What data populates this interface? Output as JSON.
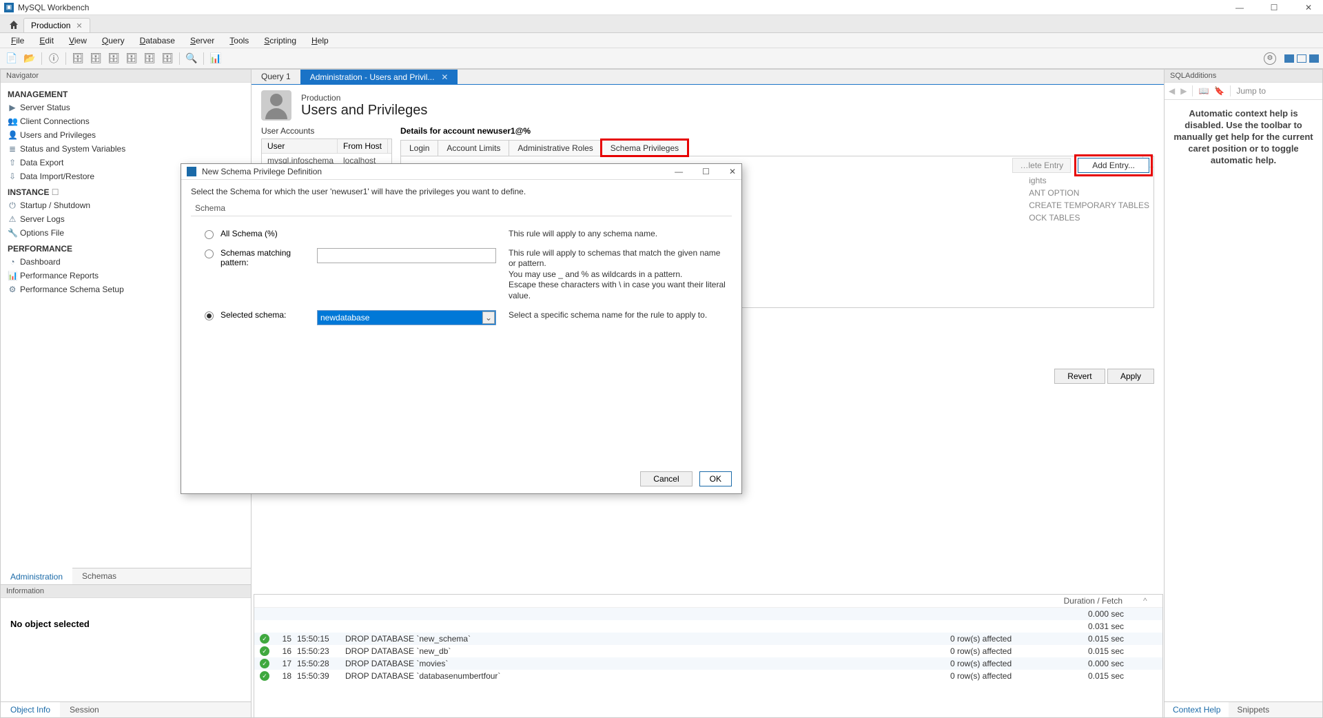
{
  "app": {
    "title": "MySQL Workbench"
  },
  "connection_tab": {
    "name": "Production"
  },
  "menu": [
    "File",
    "Edit",
    "View",
    "Query",
    "Database",
    "Server",
    "Tools",
    "Scripting",
    "Help"
  ],
  "navigator": {
    "title": "Navigator",
    "sections": {
      "management": {
        "label": "MANAGEMENT",
        "items": [
          "Server Status",
          "Client Connections",
          "Users and Privileges",
          "Status and System Variables",
          "Data Export",
          "Data Import/Restore"
        ]
      },
      "instance": {
        "label": "INSTANCE",
        "items": [
          "Startup / Shutdown",
          "Server Logs",
          "Options File"
        ]
      },
      "performance": {
        "label": "PERFORMANCE",
        "items": [
          "Dashboard",
          "Performance Reports",
          "Performance Schema Setup"
        ]
      }
    },
    "bottom_tabs": [
      "Administration",
      "Schemas"
    ],
    "info_header": "Information",
    "info_text": "No object selected",
    "obj_tabs": [
      "Object Info",
      "Session"
    ]
  },
  "center": {
    "tabs": [
      {
        "label": "Query 1",
        "active": false
      },
      {
        "label": "Administration - Users and Privil...",
        "active": true
      }
    ],
    "header": {
      "subtitle": "Production",
      "title": "Users and Privileges"
    },
    "user_accounts": {
      "label": "User Accounts",
      "columns": [
        "User",
        "From Host"
      ],
      "rows": [
        [
          "mysql.infoschema",
          "localhost"
        ]
      ]
    },
    "details": {
      "title": "Details for account newuser1@%",
      "tabs": [
        "Login",
        "Account Limits",
        "Administrative Roles",
        "Schema Privileges"
      ],
      "rights_hint_title": "ights",
      "rights": [
        "ANT OPTION",
        "CREATE TEMPORARY TABLES",
        "OCK TABLES"
      ],
      "delete_entry": "…lete Entry",
      "add_entry": "Add Entry...",
      "revert": "Revert",
      "apply": "Apply"
    }
  },
  "sqladd": {
    "title": "SQLAdditions",
    "jump": "Jump to",
    "help_text": "Automatic context help is disabled. Use the toolbar to manually get help for the current caret position or to toggle automatic help.",
    "tabs": [
      "Context Help",
      "Snippets"
    ]
  },
  "modal": {
    "title": "New Schema Privilege Definition",
    "instruction": "Select the Schema for which the user 'newuser1' will have the privileges you want to define.",
    "group": "Schema",
    "opt1_label": "All Schema (%)",
    "opt1_desc": "This rule will apply to any schema name.",
    "opt2_label": "Schemas matching pattern:",
    "opt2_desc": "This rule will apply to schemas that match the given name or pattern.\nYou may use _ and % as wildcards in a pattern.\nEscape these characters with \\ in case you want their literal value.",
    "opt3_label": "Selected schema:",
    "opt3_value": "newdatabase",
    "opt3_desc": "Select a specific schema name for the rule to apply to.",
    "cancel": "Cancel",
    "ok": "OK"
  },
  "output": {
    "header_duration": "Duration / Fetch",
    "rows": [
      {
        "idx": "",
        "time": "",
        "sql": "",
        "affected": "",
        "duration": "0.000 sec"
      },
      {
        "idx": "",
        "time": "",
        "sql": "",
        "affected": "",
        "duration": "0.031 sec"
      },
      {
        "idx": "15",
        "time": "15:50:15",
        "sql": "DROP DATABASE `new_schema`",
        "affected": "0 row(s) affected",
        "duration": "0.015 sec"
      },
      {
        "idx": "16",
        "time": "15:50:23",
        "sql": "DROP DATABASE `new_db`",
        "affected": "0 row(s) affected",
        "duration": "0.015 sec"
      },
      {
        "idx": "17",
        "time": "15:50:28",
        "sql": "DROP DATABASE `movies`",
        "affected": "0 row(s) affected",
        "duration": "0.000 sec"
      },
      {
        "idx": "18",
        "time": "15:50:39",
        "sql": "DROP DATABASE `databasenumbertfour`",
        "affected": "0 row(s) affected",
        "duration": "0.015 sec"
      }
    ]
  }
}
